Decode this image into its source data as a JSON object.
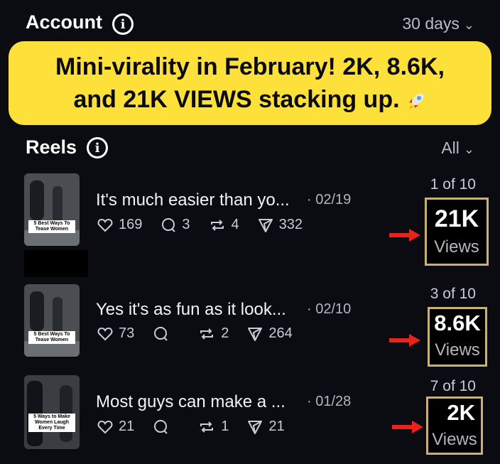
{
  "header": {
    "title": "Account",
    "range": "30 days"
  },
  "banner": {
    "line1": "Mini-virality in February! 2K, 8.6K,",
    "line2": "and 21K VIEWS stacking up."
  },
  "reels": {
    "title": "Reels",
    "filter": "All",
    "items": [
      {
        "title": "It's much easier than yo...",
        "date": "· 02/19",
        "likes": "169",
        "comments": "3",
        "reposts": "4",
        "shares": "332",
        "rank": "1 of 10",
        "views": "21K",
        "views_label": "Views",
        "thumb_caption": "5 Best Ways To Tease Women"
      },
      {
        "title": "Yes it's as fun as it look...",
        "date": "· 02/10",
        "likes": "73",
        "comments": "",
        "reposts": "2",
        "shares": "264",
        "rank": "3 of 10",
        "views": "8.6K",
        "views_label": "Views",
        "thumb_caption": "5 Best Ways To Tease Women"
      },
      {
        "title": "Most guys can make a ...",
        "date": "· 01/28",
        "likes": "21",
        "comments": "",
        "reposts": "1",
        "shares": "21",
        "rank": "7 of 10",
        "views": "2K",
        "views_label": "Views",
        "thumb_caption": "5 Ways to Make Women Laugh Every Time"
      }
    ]
  },
  "colors": {
    "banner": "#fde13a",
    "arrow": "#e8231c",
    "box_border": "#c7b07a"
  }
}
